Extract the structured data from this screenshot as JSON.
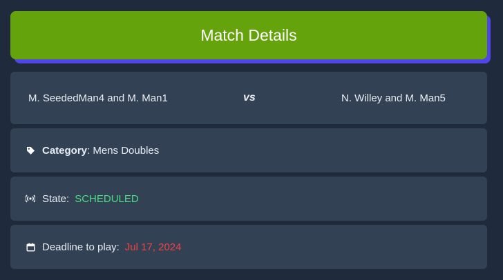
{
  "header": {
    "title": "Match Details"
  },
  "match": {
    "team_a": "M. SeededMan4 and M. Man1",
    "vs": "vs",
    "team_b": "N. Willey and M. Man5"
  },
  "category": {
    "icon": "tag-icon",
    "label": "Category",
    "separator": ":",
    "value": "Mens Doubles"
  },
  "state": {
    "icon": "broadcast-icon",
    "label": "State:",
    "value": "SCHEDULED",
    "value_color": "#4ade80"
  },
  "deadline": {
    "icon": "calendar-icon",
    "label": "Deadline to play:",
    "value": "Jul 17, 2024",
    "value_color": "#ef4444"
  },
  "colors": {
    "background": "#1f2a3d",
    "header": "#65a30d",
    "header_shadow": "#5046e5",
    "card": "#334155"
  }
}
